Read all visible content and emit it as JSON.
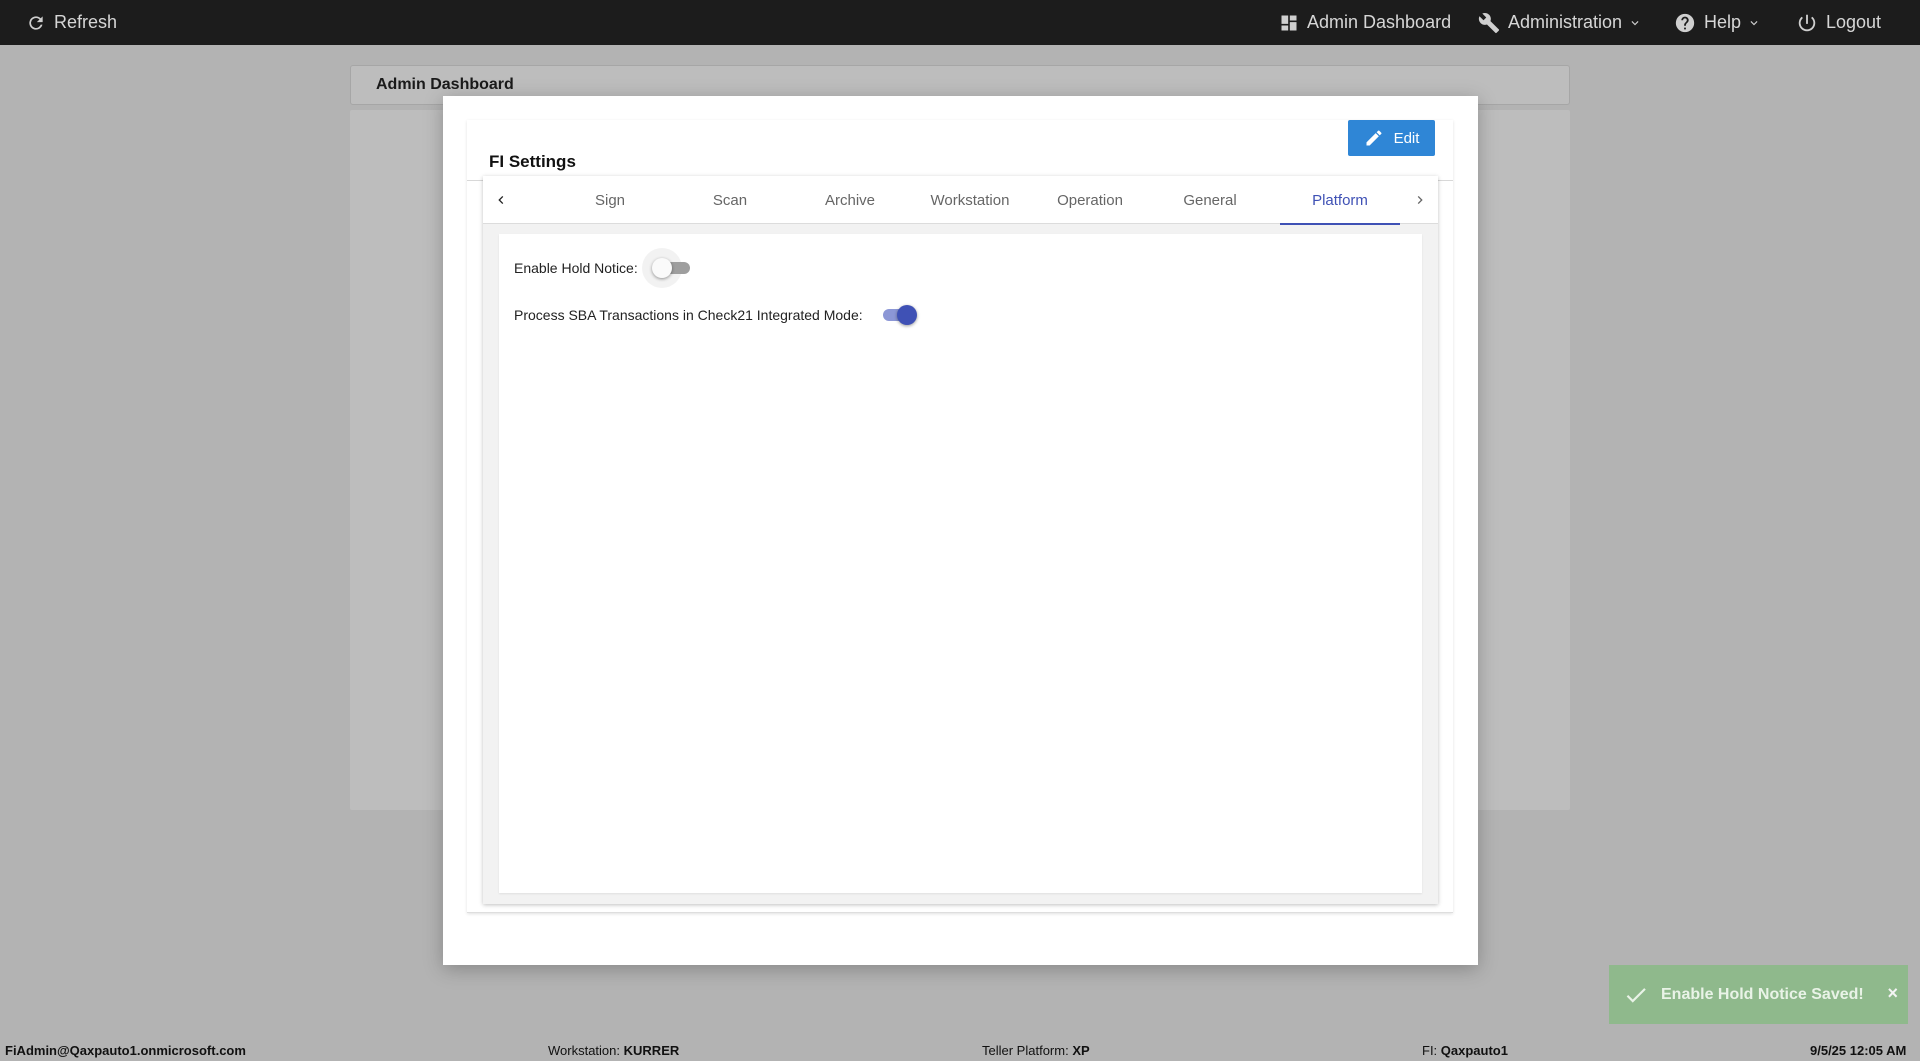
{
  "topbar": {
    "refresh_label": "Refresh",
    "admin_dashboard_label": "Admin Dashboard",
    "administration_label": "Administration",
    "help_label": "Help",
    "logout_label": "Logout"
  },
  "dashboard": {
    "title": "Admin Dashboard"
  },
  "modal": {
    "title": "FI Settings",
    "edit_label": "Edit",
    "tabs": [
      {
        "label": "Sign"
      },
      {
        "label": "Scan"
      },
      {
        "label": "Archive"
      },
      {
        "label": "Workstation"
      },
      {
        "label": "Operation"
      },
      {
        "label": "General"
      },
      {
        "label": "Platform"
      }
    ],
    "active_tab": "Platform",
    "settings": [
      {
        "label": "Enable Hold Notice:",
        "enabled": false
      },
      {
        "label": "Process SBA Transactions in Check21 Integrated Mode:",
        "enabled": true
      }
    ]
  },
  "toast": {
    "message": "Enable Hold Notice Saved!",
    "close_glyph": "×"
  },
  "statusbar": {
    "user": "FiAdmin@Qaxpauto1.onmicrosoft.com",
    "workstation_label": "Workstation:",
    "workstation_value": "KURRER",
    "teller_platform_label": "Teller Platform:",
    "teller_platform_value": "XP",
    "fi_label": "FI:",
    "fi_value": "Qaxpauto1",
    "datetime": "9/5/25 12:05 AM"
  },
  "colors": {
    "topbar_bg": "#1c1c1c",
    "accent": "#3f51b5",
    "edit_button": "#2f86d6",
    "toast_bg": "#8fb98c",
    "overlay": "#b3b3b3"
  },
  "icons": {
    "refresh": "refresh-icon",
    "dashboard": "dashboard-icon",
    "administration": "wrench-icon",
    "help": "help-icon",
    "logout": "power-icon",
    "edit": "pencil-icon",
    "toast": "check-icon"
  }
}
